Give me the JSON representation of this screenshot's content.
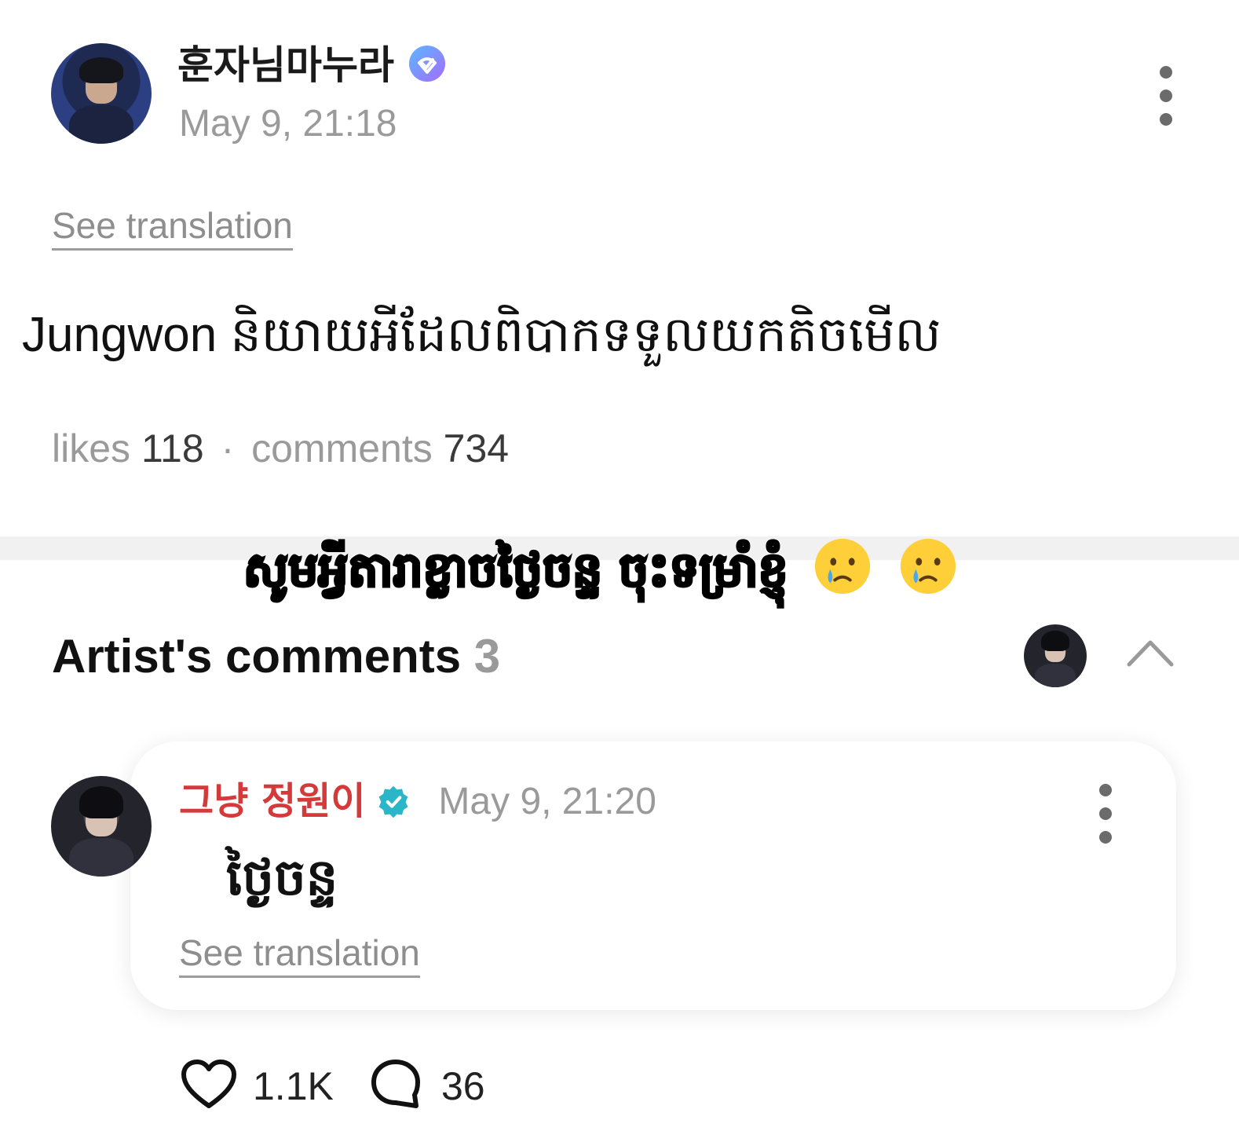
{
  "post": {
    "username": "훈자님마누라",
    "timestamp": "May 9, 21:18",
    "see_translation": "See translation",
    "text": "Jungwon និយាយអីដែលពិបាកទទួលយកតិចមើល",
    "stats": {
      "likes_label": "likes",
      "likes_count": "118",
      "separator": "·",
      "comments_label": "comments",
      "comments_count": "734"
    }
  },
  "overlay": {
    "caption": "សូមអ្វីតារាខ្លាចថ្ងៃចន្ទ ចុះទម្រាំខ្ញុំ",
    "emoji": [
      "crying-face",
      "crying-face"
    ]
  },
  "artist_comments": {
    "title": "Artist's comments",
    "count": "3"
  },
  "comment": {
    "author": "그냥 정원이",
    "timestamp": "May 9, 21:20",
    "text": "ថ្ងៃចន្ទ",
    "see_translation": "See translation",
    "likes": "1.1K",
    "replies": "36"
  },
  "colors": {
    "verified_gradient_start": "#5ab8ff",
    "verified_gradient_end": "#a56bff",
    "artist_badge": "#2bb5c8",
    "artist_name": "#d43a3a",
    "muted_text": "#9a9a9a"
  }
}
